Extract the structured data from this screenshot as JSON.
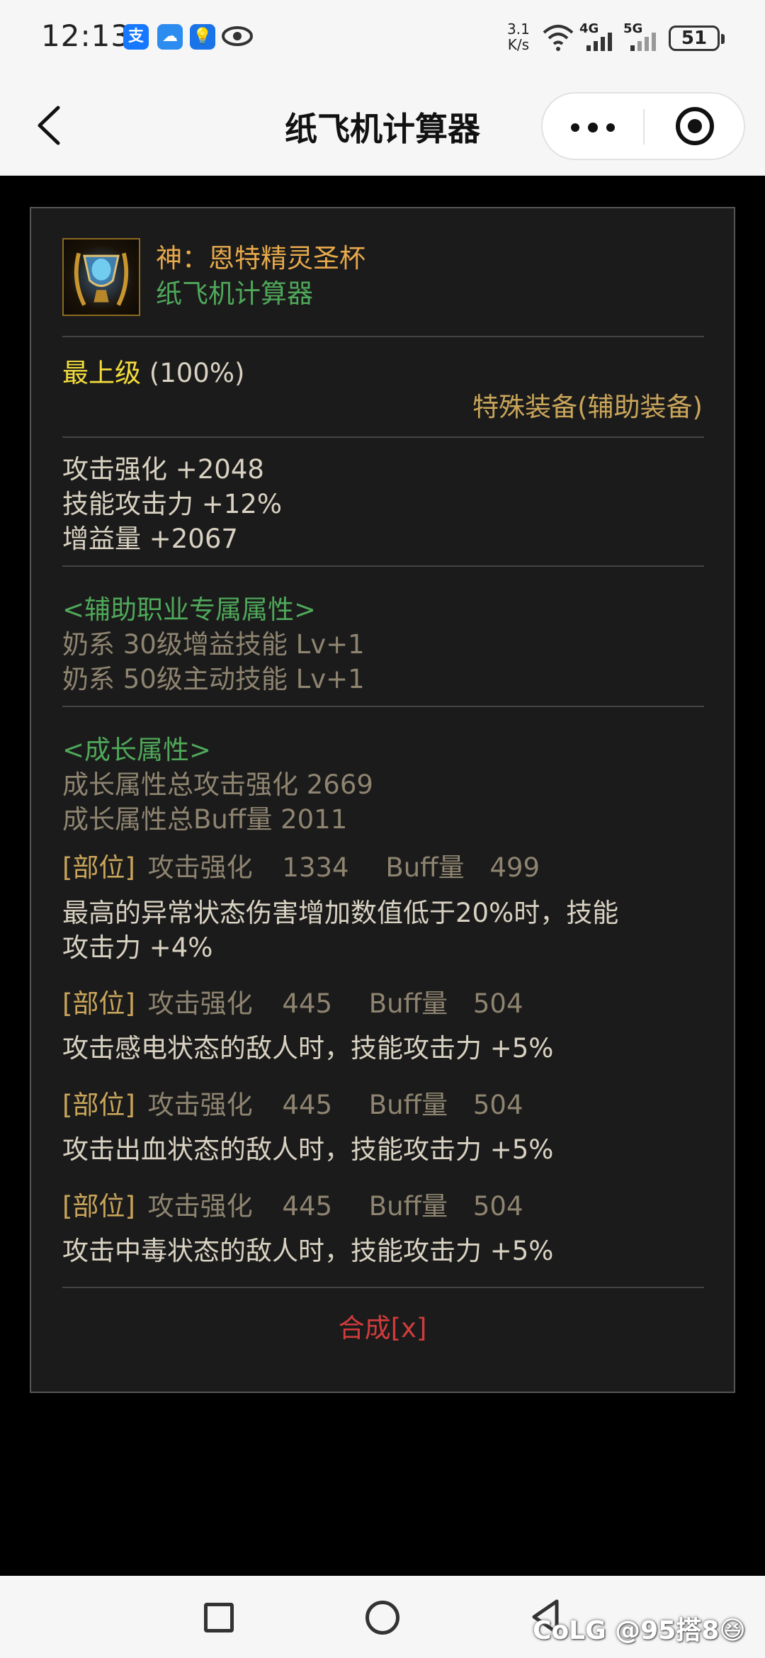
{
  "status_bar": {
    "time": "12:13",
    "net_speed_value": "3.1",
    "net_speed_unit": "K/s",
    "signal_1": "4G",
    "signal_2": "5G",
    "battery": "51"
  },
  "nav": {
    "title": "纸飞机计算器"
  },
  "item": {
    "name": "神：恩特精灵圣杯",
    "subtitle": "纸飞机计算器",
    "grade": "最上级",
    "grade_percent": "(100%)",
    "type": "特殊装备(辅助装备)",
    "stats": [
      "攻击强化 +2048",
      "技能攻击力 +12%",
      "增益量 +2067"
    ],
    "exclusive_header": "<辅助职业专属属性>",
    "exclusive_lines": [
      "奶系 30级增益技能 Lv+1",
      "奶系 50级主动技能 Lv+1"
    ],
    "growth_header": "<成长属性>",
    "growth_lines": [
      "成长属性总攻击强化 2669",
      "成长属性总Buff量 2011"
    ],
    "parts": [
      {
        "label": "[部位]",
        "atk_label": "攻击强化",
        "atk": "1334",
        "buff_label": "Buff量",
        "buff": "499",
        "effect": "最高的异常状态伤害增加数值低于20%时，技能",
        "effect2": "攻击力 +4%"
      },
      {
        "label": "[部位]",
        "atk_label": "攻击强化",
        "atk": "445",
        "buff_label": "Buff量",
        "buff": "504",
        "effect": "攻击感电状态的敌人时，技能攻击力 +5%"
      },
      {
        "label": "[部位]",
        "atk_label": "攻击强化",
        "atk": "445",
        "buff_label": "Buff量",
        "buff": "504",
        "effect": "攻击出血状态的敌人时，技能攻击力 +5%"
      },
      {
        "label": "[部位]",
        "atk_label": "攻击强化",
        "atk": "445",
        "buff_label": "Buff量",
        "buff": "504",
        "effect": "攻击中毒状态的敌人时，技能攻击力 +5%"
      }
    ],
    "synth": "合成[x]"
  },
  "watermark": "CoLG @95搭8😆",
  "colors": {
    "gold": "#e7a94b",
    "green": "#4fa85a",
    "yellow": "#f2dc3c",
    "red": "#d03c3c",
    "panel": "#1b1b1b"
  }
}
